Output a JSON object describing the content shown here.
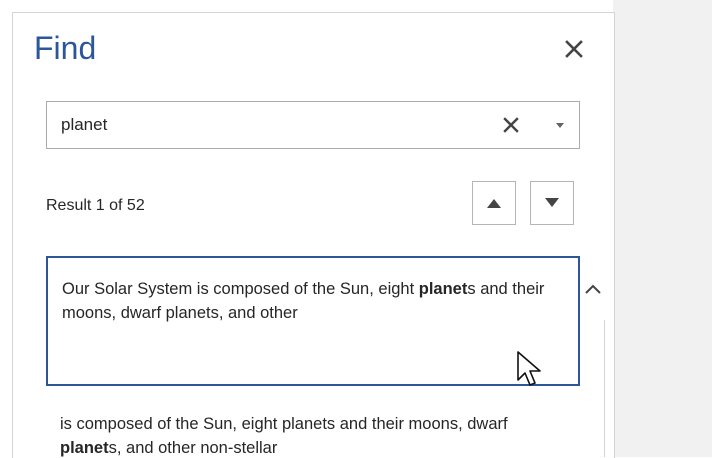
{
  "pane": {
    "title": "Find",
    "close_icon": "close-icon",
    "accent_color": "#2b579a"
  },
  "search": {
    "value": "planet",
    "clear_icon": "clear-icon",
    "dropdown_icon": "chevron-down-icon"
  },
  "results": {
    "count_text": "Result 1 of 52",
    "prev_icon": "triangle-up-icon",
    "next_icon": "triangle-down-icon",
    "items": [
      {
        "before": "Our Solar System is composed of the Sun, eight ",
        "match": "planet",
        "after": "s and their moons, dwarf planets, and other",
        "selected": true
      },
      {
        "before": "is composed of the Sun, eight planets and their moons, dwarf ",
        "match": "planet",
        "after": "s, and other non-stellar",
        "selected": false
      }
    ]
  }
}
